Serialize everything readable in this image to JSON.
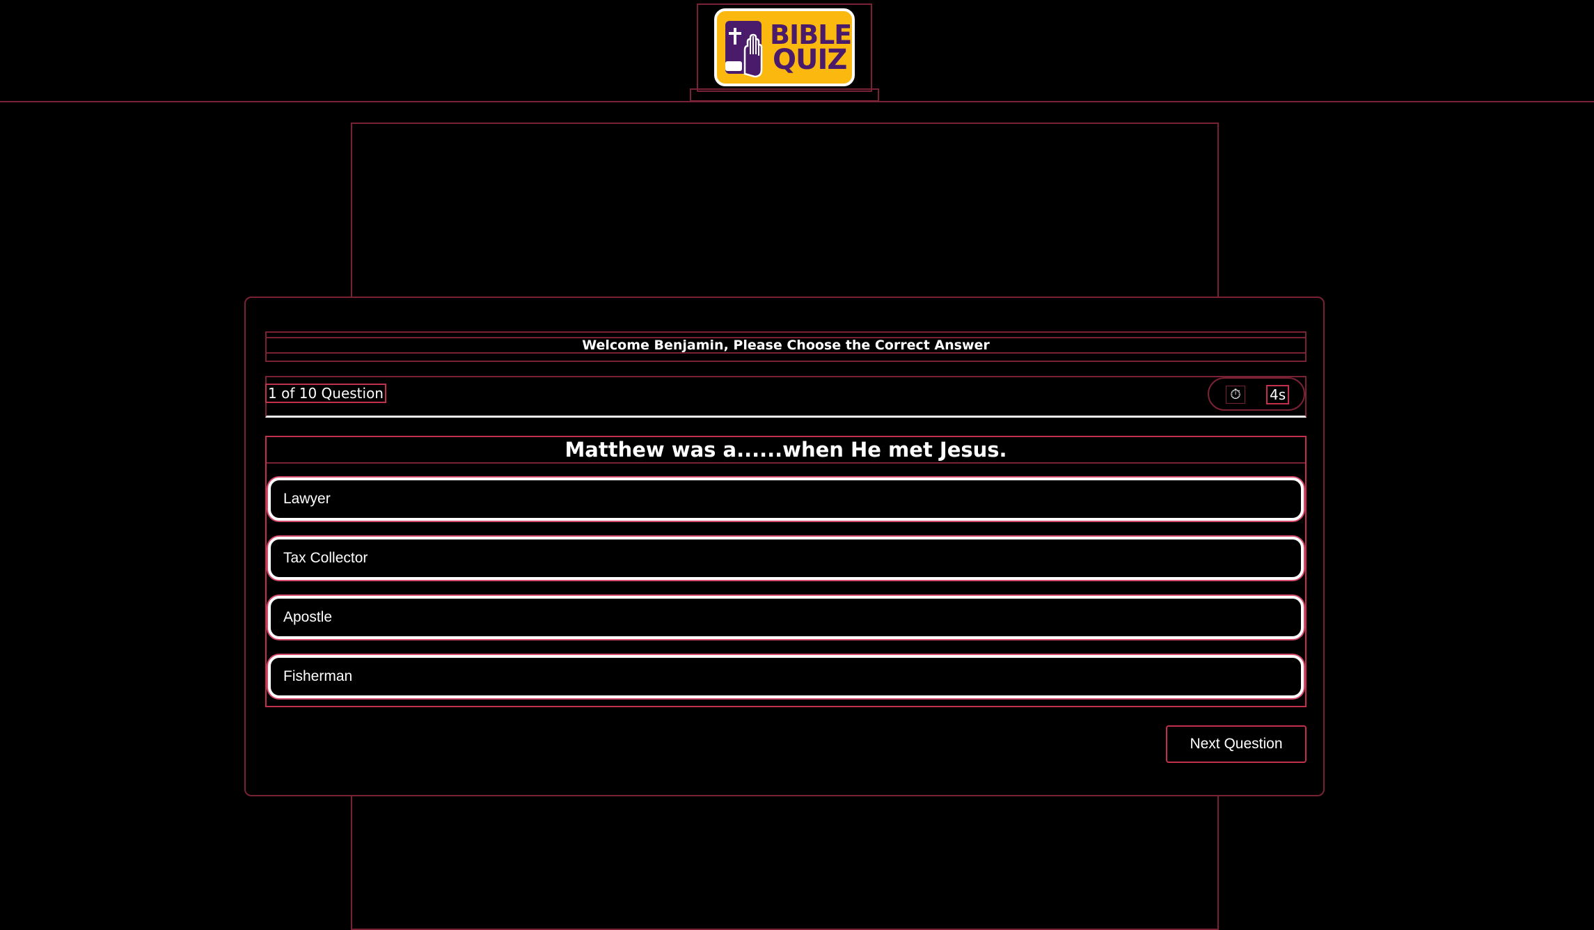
{
  "logo": {
    "line1": "BIBLE",
    "line2": "QUIZ",
    "icon": "bible-hand-cross-icon",
    "background_color": "#fbb80f",
    "text_color": "#4a1b6b"
  },
  "quiz": {
    "welcome": "Welcome Benjamin, Please Choose the Correct Answer",
    "progress": "1 of 10 Question",
    "timer": {
      "icon": "stopwatch-icon",
      "glyph": "⏱",
      "value": "4s"
    },
    "question": "Matthew was a......when He met Jesus.",
    "options": [
      "Lawyer",
      "Tax Collector",
      "Apostle",
      "Fisherman"
    ],
    "next_label": "Next Question"
  },
  "colors": {
    "background": "#000000",
    "outline": "#7a2235",
    "accent": "#c2304c",
    "option_border": "#ffffff"
  }
}
